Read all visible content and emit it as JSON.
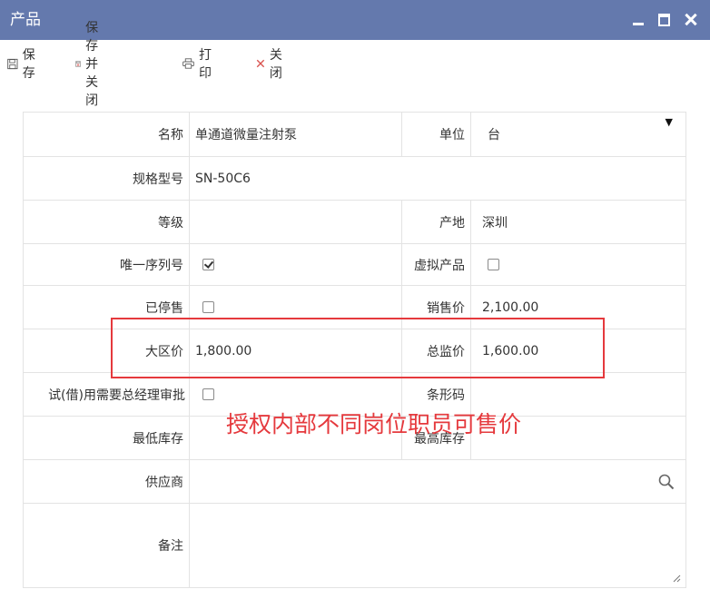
{
  "window": {
    "title": "产品"
  },
  "toolbar": {
    "save": "保存",
    "save_close": "保存并关闭",
    "print": "打 印",
    "close": "关 闭"
  },
  "form": {
    "name_label": "名称",
    "name_value": "单通道微量注射泵",
    "unit_label": "单位",
    "unit_value": "台",
    "model_label": "规格型号",
    "model_value": "SN-50C6",
    "grade_label": "等级",
    "grade_value": "",
    "origin_label": "产地",
    "origin_value": "深圳",
    "serial_label": "唯一序列号",
    "serial_checked": true,
    "virtual_label": "虚拟产品",
    "virtual_checked": false,
    "discontinued_label": "已停售",
    "discontinued_checked": false,
    "sale_price_label": "销售价",
    "sale_price_value": "2,100.00",
    "region_price_label": "大区价",
    "region_price_value": "1,800.00",
    "director_price_label": "总监价",
    "director_price_value": "1,600.00",
    "trial_label": "试(借)用需要总经理审批",
    "trial_checked": false,
    "barcode_label": "条形码",
    "barcode_value": "",
    "min_stock_label": "最低库存",
    "min_stock_value": "",
    "max_stock_label": "最高库存",
    "max_stock_value": "",
    "supplier_label": "供应商",
    "supplier_value": "",
    "remark_label": "备注",
    "remark_value": ""
  },
  "annotation": "授权内部不同岗位职员可售价",
  "colors": {
    "titlebar": "#6479ad",
    "highlight": "#e5393d"
  },
  "icons": [
    "save-icon",
    "save-close-icon",
    "print-icon",
    "close-x-icon",
    "search-icon",
    "minimize-icon",
    "maximize-icon",
    "window-close-icon",
    "resize-handle-icon"
  ]
}
